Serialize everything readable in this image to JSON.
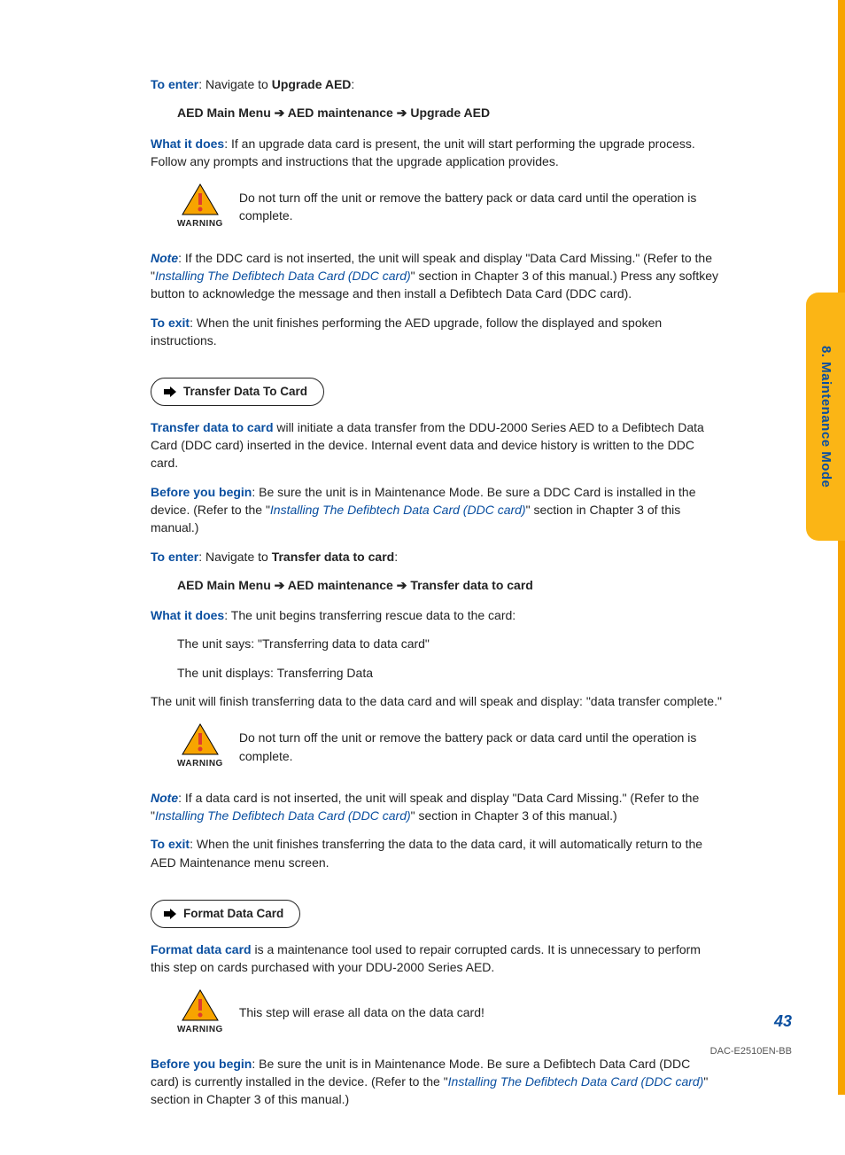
{
  "sideTab": "8.  Maintenance Mode",
  "s1": {
    "toEnterLabel": "To enter",
    "toEnterText": ": Navigate to ",
    "toEnterTarget": "Upgrade AED",
    "breadcrumb": {
      "a": "AED Main Menu",
      "b": "AED maintenance",
      "c": "Upgrade AED"
    },
    "whatLabel": "What it does",
    "whatText": ": If an upgrade data card is present, the unit will start performing the upgrade process. Follow any prompts and instructions that the upgrade application provides.",
    "warnLabel": "WARNING",
    "warnText": "Do not turn off the unit or remove the battery pack or data card until the operation is complete.",
    "noteLabel": "Note",
    "noteA": ": If the DDC card is not inserted, the unit will speak and display \"Data Card Missing.\" (Refer to the \"",
    "noteLink": "Installing The Defibtech Data Card (DDC card)",
    "noteB": "\" section in Chapter 3 of this manual.) Press any softkey button to acknowledge the message and then install a Defibtech Data Card (DDC card).",
    "exitLabel": "To exit",
    "exitText": ": When the unit finishes performing the AED upgrade, follow the displayed and spoken instructions."
  },
  "s2": {
    "heading": "Transfer Data To Card",
    "introLabel": "Transfer data to card",
    "introText": " will initiate a data transfer from the DDU-2000 Series AED to a Defibtech Data Card (DDC card) inserted in the device.  Internal event data and device history is written to the DDC card.",
    "beforeLabel": "Before you begin",
    "beforeA": ": Be sure the unit is in Maintenance Mode.  Be sure a DDC Card is installed in the device. (Refer to the \"",
    "beforeLink": "Installing The Defibtech Data Card (DDC card)",
    "beforeB": "\" section in Chapter 3 of this manual.)",
    "toEnterLabel": "To enter",
    "toEnterText": ": Navigate to ",
    "toEnterTarget": "Transfer data to card",
    "breadcrumb": {
      "a": "AED Main Menu",
      "b": "AED maintenance",
      "c": "Transfer data to card"
    },
    "whatLabel": "What it does",
    "whatText": ": The unit begins transferring rescue data to the card:",
    "says": "The unit says: \"Transferring data to data card\"",
    "displays": "The unit displays: Transferring Data",
    "finish": "The unit will finish transferring data to the data card and will speak and display: \"data transfer complete.\"",
    "warnLabel": "WARNING",
    "warnText": "Do not turn off the unit or remove the battery pack or data card until the operation is complete.",
    "noteLabel": "Note",
    "noteA": ": If a data card is not inserted, the unit will speak and display \"Data Card Missing.\" (Refer to the \"",
    "noteLink": "Installing The Defibtech Data Card (DDC card)",
    "noteB": "\" section in Chapter 3 of this manual.)",
    "exitLabel": "To exit",
    "exitText": ": When the unit finishes transferring the data to the data card, it will automatically return to the AED Maintenance menu screen."
  },
  "s3": {
    "heading": "Format Data Card",
    "introLabel": "Format data card",
    "introText": " is a maintenance tool used to repair corrupted cards.  It is unnecessary to perform this step on cards purchased with your DDU-2000 Series AED.",
    "warnLabel": "WARNING",
    "warnText": "This step will erase all data on the data card!",
    "beforeLabel": "Before you begin",
    "beforeA": ": Be sure the unit is in Maintenance Mode. Be sure a Defibtech Data Card (DDC card) is currently installed in the device. (Refer to the \"",
    "beforeLink": "Installing The Defibtech Data Card (DDC card)",
    "beforeB": "\" section in Chapter 3 of this manual.)"
  },
  "pageNumber": "43",
  "docId": "DAC-E2510EN-BB"
}
